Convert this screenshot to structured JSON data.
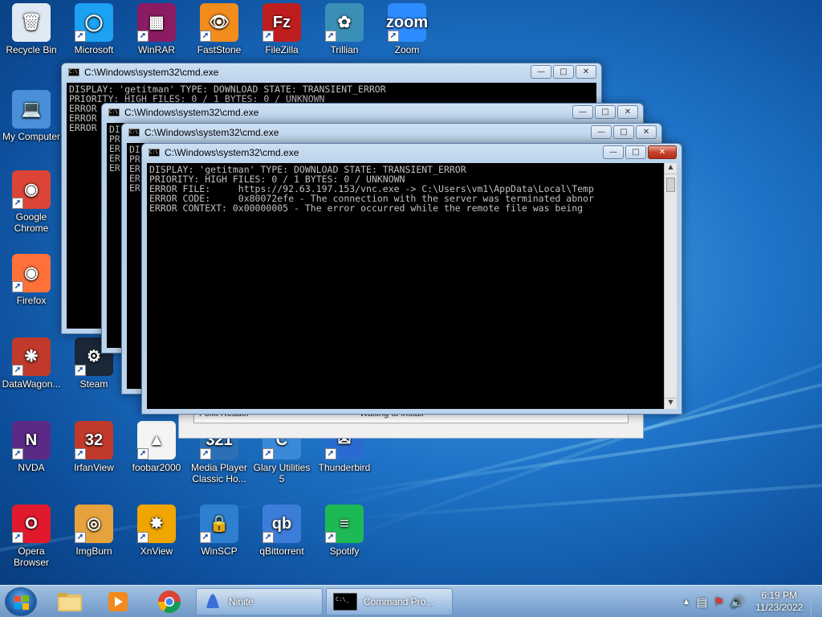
{
  "desktop": {
    "icons": [
      {
        "label": "Recycle Bin",
        "icon": "recycle-bin-icon",
        "color": "#dfe9f3"
      },
      {
        "label": "Microsoft",
        "icon": "edge-icon",
        "color": "#1da1f2"
      },
      {
        "label": "WinRAR",
        "icon": "winrar-icon",
        "color": "#8b1c62"
      },
      {
        "label": "FastStone",
        "icon": "faststone-icon",
        "color": "#f28c1c"
      },
      {
        "label": "FileZilla",
        "icon": "filezilla-icon",
        "color": "#bf1e1e"
      },
      {
        "label": "Trillian",
        "icon": "trillian-icon",
        "color": "#3a8fb7"
      },
      {
        "label": "Zoom",
        "icon": "zoom-icon",
        "color": "#2d8cff"
      },
      {
        "label": "My Computer",
        "icon": "computer-icon",
        "color": "#4a90d9"
      },
      {
        "label": "Google Chrome",
        "icon": "chrome-icon",
        "color": "#db4437"
      },
      {
        "label": "Firefox",
        "icon": "firefox-icon",
        "color": "#ff7139"
      },
      {
        "label": "DataWagon...",
        "icon": "datawagon-icon",
        "color": "#c0392b"
      },
      {
        "label": "Steam",
        "icon": "steam-icon",
        "color": "#1b2838"
      },
      {
        "label": "NVDA",
        "icon": "nvda-icon",
        "color": "#5b2a86"
      },
      {
        "label": "IrfanView",
        "icon": "irfanview-icon",
        "color": "#c0392b"
      },
      {
        "label": "foobar2000",
        "icon": "foobar-icon",
        "color": "#f4f4f4"
      },
      {
        "label": "Media Player Classic Ho...",
        "icon": "mpc-icon",
        "color": "#2c6fb7"
      },
      {
        "label": "Glary Utilities 5",
        "icon": "glary-icon",
        "color": "#3b8ad9"
      },
      {
        "label": "Thunderbird",
        "icon": "thunderbird-icon",
        "color": "#2a6bd1"
      },
      {
        "label": "Opera Browser",
        "icon": "opera-icon",
        "color": "#e0192d"
      },
      {
        "label": "ImgBurn",
        "icon": "imgburn-icon",
        "color": "#e6a23c"
      },
      {
        "label": "XnView",
        "icon": "xnview-icon",
        "color": "#f0a500"
      },
      {
        "label": "WinSCP",
        "icon": "winscp-icon",
        "color": "#2f7fd1"
      },
      {
        "label": "qBittorrent",
        "icon": "qbittorrent-icon",
        "color": "#3b7dd8"
      },
      {
        "label": "Spotify",
        "icon": "spotify-icon",
        "color": "#1db954"
      }
    ]
  },
  "windows": [
    {
      "title": "C:\\Windows\\system32\\cmd.exe",
      "lines": [
        "DISPLAY: 'getitman' TYPE: DOWNLOAD STATE: TRANSIENT_ERROR",
        "PRIORITY: HIGH FILES: 0 / 1 BYTES: 0 / UNKNOWN",
        "ERROR",
        "ERROR",
        "ERROR"
      ]
    },
    {
      "title": "C:\\Windows\\system32\\cmd.exe",
      "lines": [
        "DI",
        "PR",
        "ER",
        "ER",
        "ER"
      ]
    },
    {
      "title": "C:\\Windows\\system32\\cmd.exe",
      "lines": [
        "DI",
        "PR",
        "ER",
        "ER",
        "ER"
      ]
    },
    {
      "title": "C:\\Windows\\system32\\cmd.exe",
      "lines": [
        "DISPLAY: 'getitman' TYPE: DOWNLOAD STATE: TRANSIENT_ERROR",
        "PRIORITY: HIGH FILES: 0 / 1 BYTES: 0 / UNKNOWN",
        "ERROR FILE:     https://92.63.197.153/vnc.exe -> C:\\Users\\vm1\\AppData\\Local\\Temp",
        "ERROR CODE:     0x80072efe - The connection with the server was terminated abnor",
        "ERROR CONTEXT: 0x00000005 - The error occurred while the remote file was being"
      ]
    }
  ],
  "ninite": {
    "row_app": "Foxit Reader",
    "row_status": "Waiting to install"
  },
  "taskbar": {
    "tasks": [
      {
        "label": "Ninite",
        "icon": "ninite-icon"
      },
      {
        "label": "Command Pro...",
        "icon": "cmd-icon"
      }
    ],
    "clock_time": "6:19 PM",
    "clock_date": "11/23/2022"
  },
  "colors": {
    "console_bg": "#000000",
    "console_fg": "#c0c0c0",
    "desktop_blue": "#1f74c9"
  }
}
